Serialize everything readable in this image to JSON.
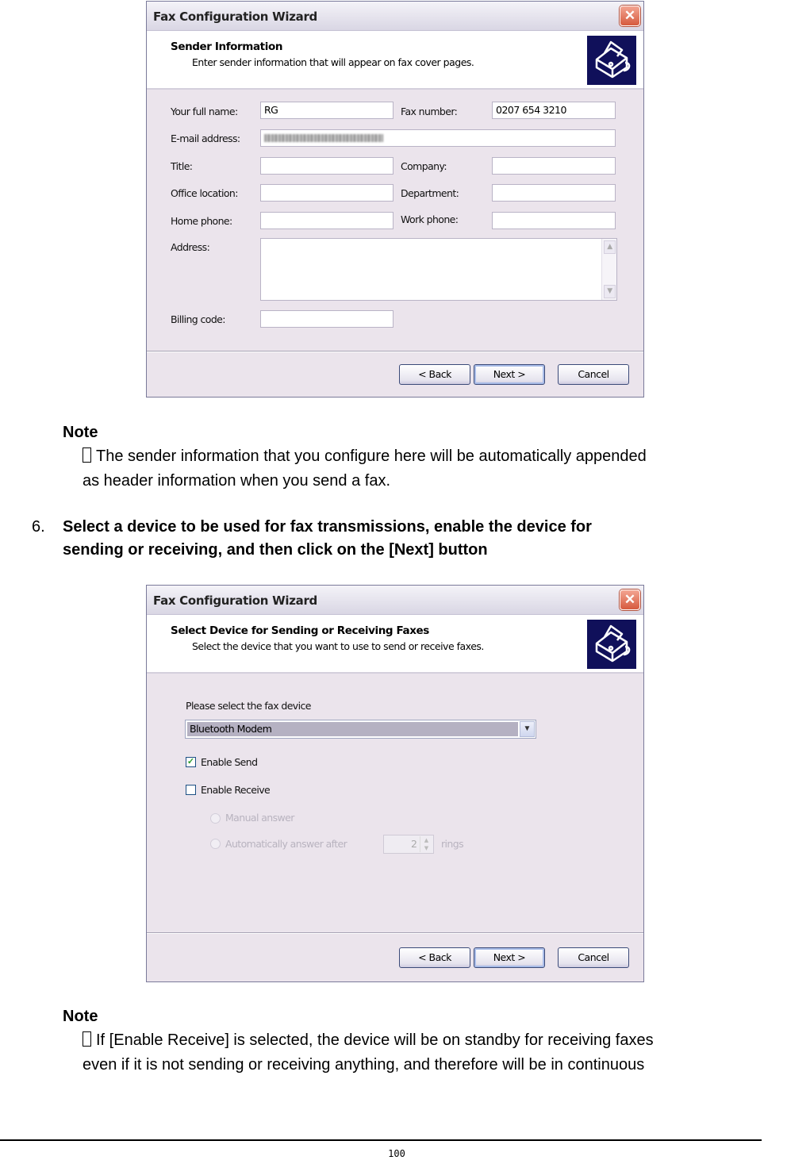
{
  "window1": {
    "title": "Fax Configuration Wizard",
    "header_title": "Sender Information",
    "header_subtitle": "Enter sender information that will appear on fax cover pages.",
    "icon": "fax-machine-icon",
    "fields": {
      "full_name": {
        "label": "Your full name:",
        "value": "RG"
      },
      "fax_number": {
        "label": "Fax number:",
        "value": "0207 654 3210"
      },
      "email": {
        "label": "E-mail address:",
        "value": "(blurred)"
      },
      "title": {
        "label": "Title:",
        "value": ""
      },
      "company": {
        "label": "Company:",
        "value": ""
      },
      "office": {
        "label": "Office location:",
        "value": ""
      },
      "department": {
        "label": "Department:",
        "value": ""
      },
      "home_phone": {
        "label": "Home phone:",
        "value": ""
      },
      "work_phone": {
        "label": "Work phone:",
        "value": ""
      },
      "address": {
        "label": "Address:",
        "value": ""
      },
      "billing": {
        "label": "Billing code:",
        "value": ""
      }
    },
    "buttons": {
      "back": "< Back",
      "next": "Next >",
      "cancel": "Cancel"
    }
  },
  "note1": {
    "heading": "Note",
    "line1": "The sender information that you configure here will be automatically appended",
    "line2": "as header information when you send a fax."
  },
  "step6": {
    "number": "6.",
    "line1": "Select a device to be used for fax transmissions, enable the device for",
    "line2": "sending or receiving, and then click on the [Next] button"
  },
  "window2": {
    "title": "Fax Configuration Wizard",
    "header_title": "Select Device for Sending or Receiving Faxes",
    "header_subtitle": "Select the device that you want to use to send or receive faxes.",
    "icon": "fax-machine-icon",
    "device_label": "Please select the fax device",
    "device_selected": "Bluetooth Modem",
    "enable_send": {
      "label": "Enable Send",
      "checked": true
    },
    "enable_receive": {
      "label": "Enable Receive",
      "checked": false
    },
    "manual_answer": "Manual answer",
    "auto_answer": "Automatically answer after",
    "rings_value": "2",
    "rings_label": "rings",
    "buttons": {
      "back": "< Back",
      "next": "Next >",
      "cancel": "Cancel"
    }
  },
  "note2": {
    "heading": "Note",
    "line1": "If [Enable Receive] is selected, the device will be on standby for receiving faxes",
    "line2": "even if it is not sending or receiving anything, and therefore will be in continuous"
  },
  "footer": {
    "page_number": "100"
  }
}
